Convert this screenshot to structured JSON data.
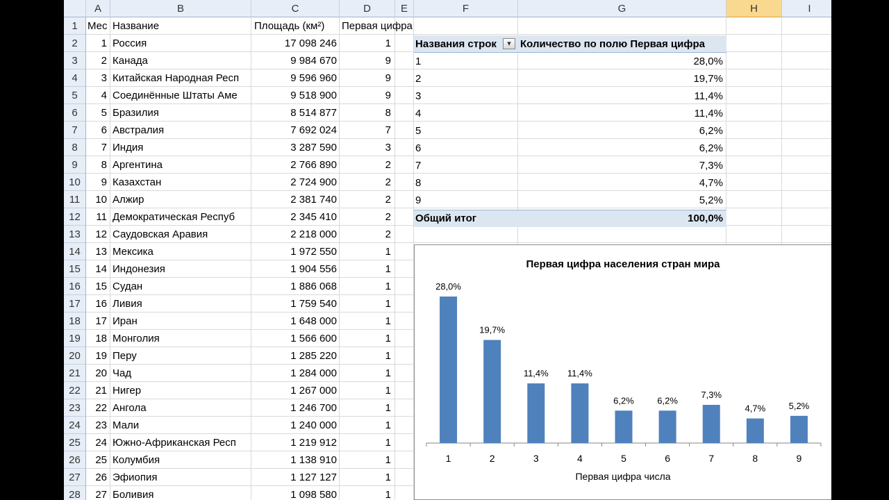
{
  "columns": [
    "A",
    "B",
    "C",
    "D",
    "E",
    "F",
    "G",
    "H",
    "I"
  ],
  "selected_column": "H",
  "row_numbers": [
    "1",
    "2",
    "3",
    "4",
    "5",
    "6",
    "7",
    "8",
    "9",
    "10",
    "11",
    "12",
    "13",
    "14",
    "15",
    "16",
    "17",
    "18",
    "19",
    "20",
    "21",
    "22",
    "23",
    "24",
    "25",
    "26",
    "27",
    "28"
  ],
  "table": {
    "headers": {
      "a": "Мес",
      "b": "Название",
      "c": "Площадь (км²)",
      "d": "Первая цифра"
    },
    "rows": [
      {
        "a": "1",
        "b": "Россия",
        "c": "17 098 246",
        "d": "1"
      },
      {
        "a": "2",
        "b": "Канада",
        "c": "9 984 670",
        "d": "9"
      },
      {
        "a": "3",
        "b": "Китайская Народная Респ",
        "c": "9 596 960",
        "d": "9"
      },
      {
        "a": "4",
        "b": "Соединённые Штаты Аме",
        "c": "9 518 900",
        "d": "9"
      },
      {
        "a": "5",
        "b": "Бразилия",
        "c": "8 514 877",
        "d": "8"
      },
      {
        "a": "6",
        "b": "Австралия",
        "c": "7 692 024",
        "d": "7"
      },
      {
        "a": "7",
        "b": "Индия",
        "c": "3 287 590",
        "d": "3"
      },
      {
        "a": "8",
        "b": "Аргентина",
        "c": "2 766 890",
        "d": "2"
      },
      {
        "a": "9",
        "b": "Казахстан",
        "c": "2 724 900",
        "d": "2"
      },
      {
        "a": "10",
        "b": "Алжир",
        "c": "2 381 740",
        "d": "2"
      },
      {
        "a": "11",
        "b": "Демократическая Респуб",
        "c": "2 345 410",
        "d": "2"
      },
      {
        "a": "12",
        "b": "Саудовская Аравия",
        "c": "2 218 000",
        "d": "2"
      },
      {
        "a": "13",
        "b": "Мексика",
        "c": "1 972 550",
        "d": "1"
      },
      {
        "a": "14",
        "b": "Индонезия",
        "c": "1 904 556",
        "d": "1"
      },
      {
        "a": "15",
        "b": "Судан",
        "c": "1 886 068",
        "d": "1"
      },
      {
        "a": "16",
        "b": "Ливия",
        "c": "1 759 540",
        "d": "1"
      },
      {
        "a": "17",
        "b": "Иран",
        "c": "1 648 000",
        "d": "1"
      },
      {
        "a": "18",
        "b": "Монголия",
        "c": "1 566 600",
        "d": "1"
      },
      {
        "a": "19",
        "b": "Перу",
        "c": "1 285 220",
        "d": "1"
      },
      {
        "a": "20",
        "b": "Чад",
        "c": "1 284 000",
        "d": "1"
      },
      {
        "a": "21",
        "b": "Нигер",
        "c": "1 267 000",
        "d": "1"
      },
      {
        "a": "22",
        "b": "Ангола",
        "c": "1 246 700",
        "d": "1"
      },
      {
        "a": "23",
        "b": "Мали",
        "c": "1 240 000",
        "d": "1"
      },
      {
        "a": "24",
        "b": "Южно-Африканская Респ",
        "c": "1 219 912",
        "d": "1"
      },
      {
        "a": "25",
        "b": "Колумбия",
        "c": "1 138 910",
        "d": "1"
      },
      {
        "a": "26",
        "b": "Эфиопия",
        "c": "1 127 127",
        "d": "1"
      },
      {
        "a": "27",
        "b": "Боливия",
        "c": "1 098 580",
        "d": "1"
      }
    ]
  },
  "pivot": {
    "row_header": "Названия строк",
    "value_header": "Количество по полю Первая цифра",
    "filter_icon": "filter-dropdown-icon",
    "rows": [
      {
        "label": "1",
        "value": "28,0%"
      },
      {
        "label": "2",
        "value": "19,7%"
      },
      {
        "label": "3",
        "value": "11,4%"
      },
      {
        "label": "4",
        "value": "11,4%"
      },
      {
        "label": "5",
        "value": "6,2%"
      },
      {
        "label": "6",
        "value": "6,2%"
      },
      {
        "label": "7",
        "value": "7,3%"
      },
      {
        "label": "8",
        "value": "4,7%"
      },
      {
        "label": "9",
        "value": "5,2%"
      }
    ],
    "total_label": "Общий итог",
    "total_value": "100,0%"
  },
  "chart_data": {
    "type": "bar",
    "title": "Первая цифра населения стран мира",
    "xlabel": "Первая цифра числа",
    "ylabel": "",
    "categories": [
      "1",
      "2",
      "3",
      "4",
      "5",
      "6",
      "7",
      "8",
      "9"
    ],
    "values": [
      28.0,
      19.7,
      11.4,
      11.4,
      6.2,
      6.2,
      7.3,
      4.7,
      5.2
    ],
    "data_labels": [
      "28,0%",
      "19,7%",
      "11,4%",
      "11,4%",
      "6,2%",
      "6,2%",
      "7,3%",
      "4,7%",
      "5,2%"
    ],
    "ylim": [
      0,
      28
    ],
    "grid": false,
    "legend": "none",
    "bar_color": "#4f81bd"
  },
  "colors": {
    "header_bg": "#e8eef7",
    "selected_header": "#f9d98f",
    "pivot_header": "#dce6f1"
  }
}
